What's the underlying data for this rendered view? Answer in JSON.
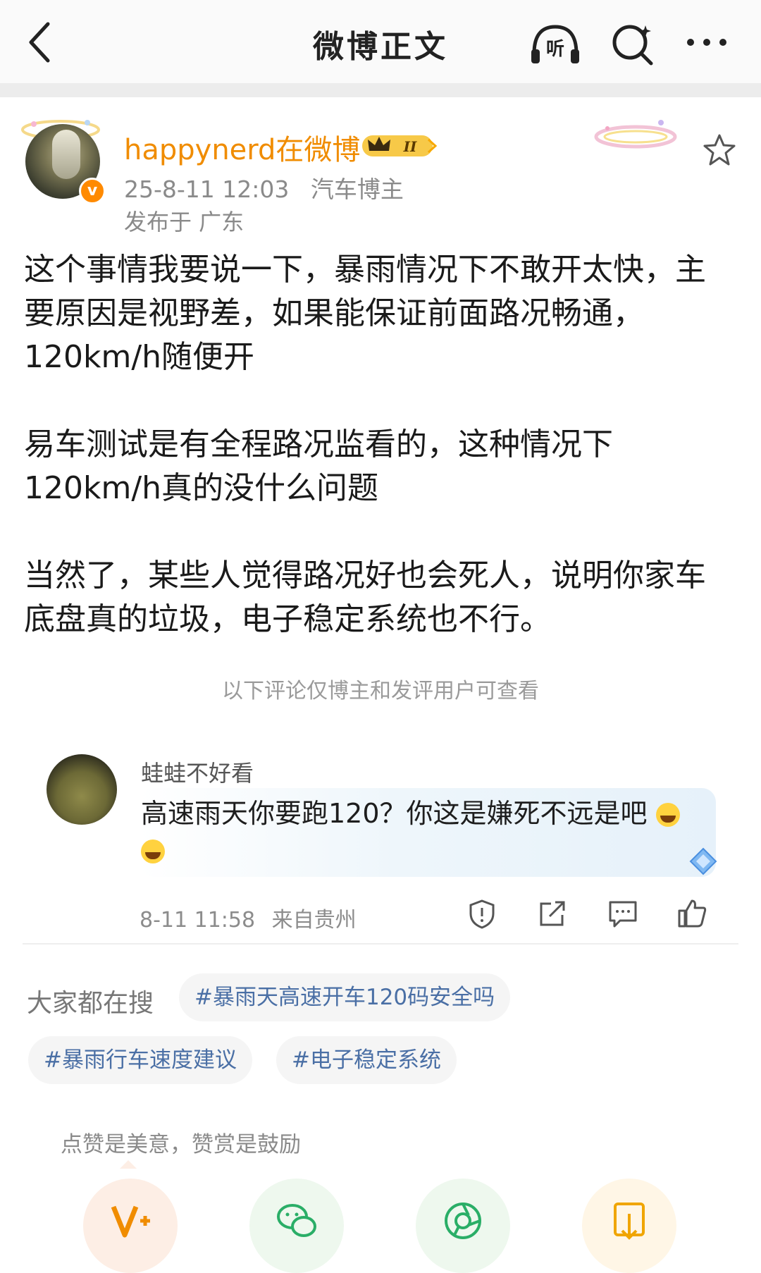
{
  "header": {
    "title": "微博正文",
    "listen_label": "听"
  },
  "post": {
    "username": "happynerd在微博",
    "level_badge": "II",
    "time": "25-8-11 12:03",
    "tag": "汽车博主",
    "location": "发布于 广东",
    "paragraphs": [
      "这个事情我要说一下，暴雨情况下不敢开太快，主要原因是视野差，如果能保证前面路况畅通，120km/h随便开",
      "易车测试是有全程路况监看的，这种情况下120km/h真的没什么问题",
      "当然了，某些人觉得路况好也会死人，说明你家车底盘真的垃圾，电子稳定系统也不行。"
    ]
  },
  "comment_note": "以下评论仅博主和发评用户可查看",
  "comment": {
    "author": "蛙蛙不好看",
    "text": "高速雨天你要跑120？你这是嫌死不远是吧",
    "time": "8-11 11:58",
    "source": "来自贵州"
  },
  "hot_search": {
    "label": "大家都在搜",
    "tags": [
      "#暴雨天高速开车120码安全吗",
      "#暴雨行车速度建议",
      "#电子稳定系统"
    ]
  },
  "reward": {
    "text": "点赞是美意，赞赏是鼓励"
  },
  "colors": {
    "username": "#f08c00",
    "tag_text": "#4a6fa5",
    "meta": "#8a8a8a"
  }
}
